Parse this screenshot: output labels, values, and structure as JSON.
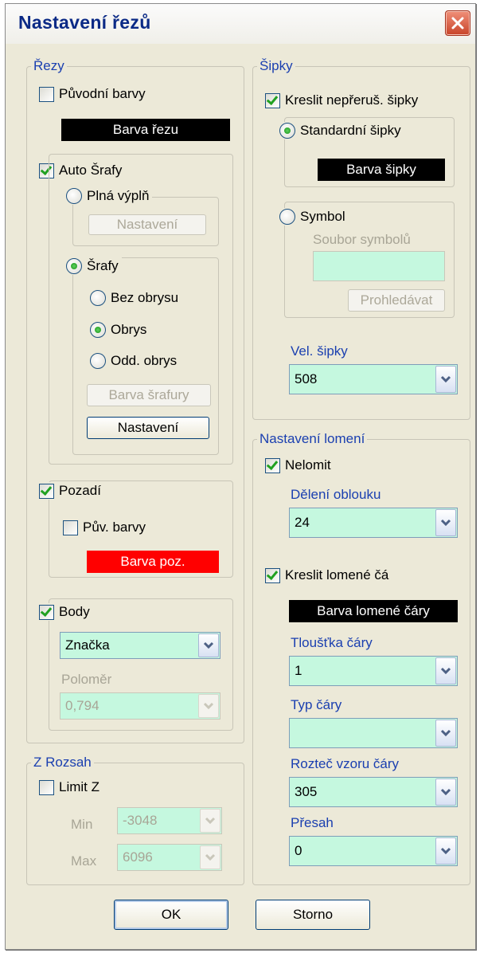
{
  "title": "Nastavení řezů",
  "rezy": {
    "group": "Řezy",
    "puvodni_barvy": "Původní barvy",
    "barva_rezu": "Barva řezu",
    "auto_srafy": "Auto Šrafy",
    "plna_vypln": "Plná výplň",
    "nastaveni_disabled": "Nastavení",
    "srafy": "Šrafy",
    "bez_obrysu": "Bez obrysu",
    "obrys": "Obrys",
    "odd_obrys": "Odd. obrys",
    "barva_srafury": "Barva šrafury",
    "nastaveni": "Nastavení",
    "pozadi": "Pozadí",
    "puv_barvy": "Pův. barvy",
    "barva_poz": "Barva poz.",
    "body": "Body",
    "znacka": "Značka",
    "polomer": "Poloměr",
    "polomer_value": "0,794"
  },
  "zrozsah": {
    "group": "Z Rozsah",
    "limit_z": "Limit Z",
    "min_label": "Min",
    "min_value": "-3048",
    "max_label": "Max",
    "max_value": "6096"
  },
  "sipky": {
    "group": "Šipky",
    "kreslit": "Kreslit nepřeruš. šipky",
    "standardni": "Standardní šipky",
    "barva_sipky": "Barva šipky",
    "symbol": "Symbol",
    "soubor_symbolu": "Soubor symbolů",
    "prohledavat": "Prohledávat",
    "vel_sipky": "Vel. šipky",
    "vel_value": "508"
  },
  "lomeni": {
    "group": "Nastavení lomení",
    "nelomit": "Nelomit",
    "deleni_oblouku": "Dělení oblouku",
    "deleni_value": "24",
    "kreslit_lomene": "Kreslit lomené čá",
    "barva_lomene": "Barva lomené čáry",
    "tloustka": "Tloušťka čáry",
    "tloustka_value": "1",
    "typ": "Typ čáry",
    "typ_value": "",
    "roztec": "Rozteč vzoru čáry",
    "roztec_value": "305",
    "presah": "Přesah",
    "presah_value": "0"
  },
  "buttons": {
    "ok": "OK",
    "storno": "Storno"
  },
  "colors": {
    "swatch_black": "#000000",
    "swatch_red": "#ff0000",
    "field_bg": "#c5f8df",
    "group_title": "#1a3fb0"
  },
  "icons": {
    "close": "close-icon",
    "dropdown": "chevron-down-icon"
  }
}
